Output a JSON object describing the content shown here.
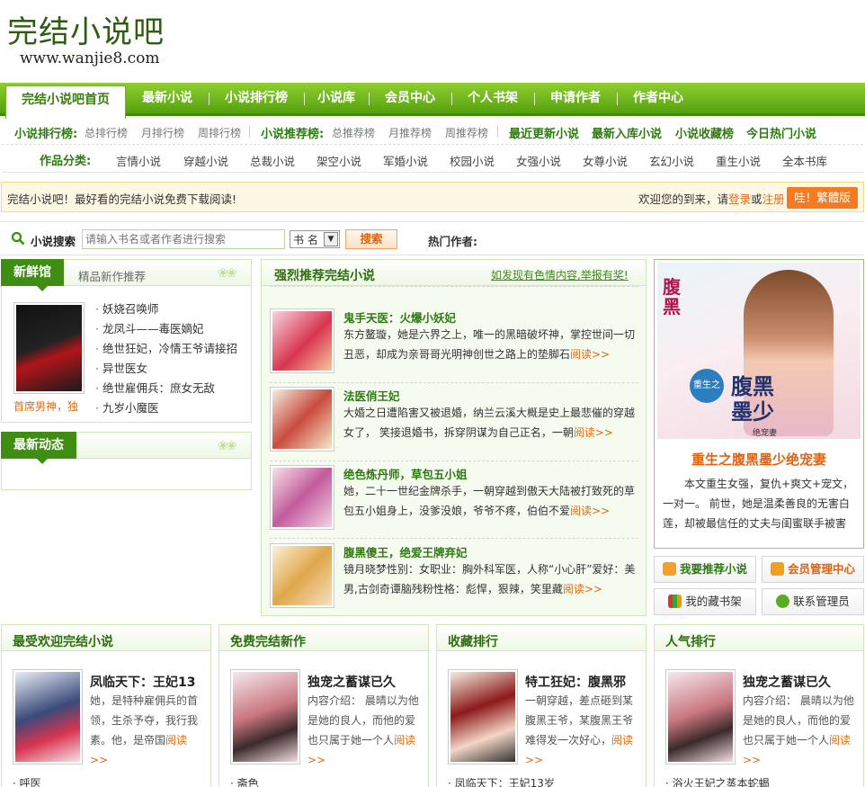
{
  "logo": {
    "cn": "完结小说吧",
    "en": "www.wanjie8.com"
  },
  "nav": [
    "完结小说吧首页",
    "最新小说",
    "小说排行榜",
    "小说库",
    "会员中心",
    "个人书架",
    "申请作者",
    "作者中心"
  ],
  "rank_bar": {
    "rank_title": "小说排行榜:",
    "rank_links": [
      "总排行榜",
      "月排行榜",
      "周排行榜"
    ],
    "rec_title": "小说推荐榜:",
    "rec_links": [
      "总推荐榜",
      "月推荐榜",
      "周推荐榜"
    ],
    "bold_links": [
      "最近更新小说",
      "最新入库小说",
      "小说收藏榜",
      "今日热门小说"
    ]
  },
  "category_bar": {
    "title": "作品分类:",
    "items": [
      "言情小说",
      "穿越小说",
      "总裁小说",
      "架空小说",
      "军婚小说",
      "校园小说",
      "女强小说",
      "女尊小说",
      "玄幻小说",
      "重生小说",
      "全本书库"
    ]
  },
  "notice": {
    "left": "完结小说吧！最好看的完结小说免费下载阅读!",
    "welcome": "欢迎您的到来，请",
    "login": "登录",
    "or": "或",
    "register": "注册",
    "fanti": "哇！繁體版"
  },
  "search": {
    "label": "小说搜索",
    "placeholder": "请输入书名或者作者进行搜索",
    "select": "书 名",
    "button": "搜索",
    "hot_authors": "热门作者:"
  },
  "fresh": {
    "tab": "新鲜馆",
    "subtitle": "精品新作推荐",
    "cover_caption": "首席男神，独",
    "items": [
      "妖娆召唤师",
      "龙凤斗——毒医嫡妃",
      "绝世狂妃，冷情王爷请接招",
      "异世医女",
      "绝世雇佣兵：庶女无敌",
      "九岁小魔医"
    ]
  },
  "dynamic": {
    "tab": "最新动态"
  },
  "recommend": {
    "title": "强烈推荐完结小说",
    "report": "如发现有色情内容,举报有奖!",
    "more": "阅读>>",
    "items": [
      {
        "title": "鬼手天医：火爆小妖妃",
        "desc": "东方鳌璇，她是六界之上，唯一的黑暗破坏神，掌控世间一切丑恶，却成为亲哥哥光明神创世之路上的垫脚石"
      },
      {
        "title": "法医俏王妃",
        "desc": "大婚之日遭陷害又被退婚，纳兰云溪大概是史上最悲催的穿越女了， 笑接退婚书，拆穿阴谋为自己正名，一朝"
      },
      {
        "title": "绝色炼丹师，草包五小姐",
        "desc": "她，二十一世纪金牌杀手，一朝穿越到傲天大陆被打致死的草包五小姐身上，没爹没娘，爷爷不疼，伯伯不爱"
      },
      {
        "title": "腹黑傻王，绝爱王牌弃妃",
        "desc": "镜月晓梦性别：女职业：胸外科军医，人称“小心肝”爱好：美男,古剑奇谭脑残粉性格：彪悍，狠辣，笑里藏"
      }
    ]
  },
  "feature": {
    "title": "重生之腹黑墨少绝宠妻",
    "desc": "本文重生女强，复仇+爽文+宠文，一对一。 前世，她是温柔善良的无害白莲，却被最信任的丈夫与闺蜜联手被害—— “若有来世，无论上天入地，",
    "cover_text_1": "腹黑",
    "cover_text_2": "墨少",
    "cover_text_3": "重生之",
    "cover_text_4": "绝宠妻"
  },
  "actions": [
    "我要推荐小说",
    "会员管理中心",
    "我的藏书架",
    "联系管理员"
  ],
  "bottom": [
    {
      "header": "最受欢迎完结小说",
      "title": "凤临天下：王妃13",
      "desc": "她，是特种雇佣兵的首领，生杀予夺，我行我素。他，是帝国",
      "more": "阅读>>",
      "tail": "· 呼医"
    },
    {
      "header": "免费完结新作",
      "title": "独宠之蓄谋已久",
      "desc": "内容介绍： 晨晴以为他是她的良人，而他的爱也只属于她一个人",
      "more": "阅读>>",
      "tail": "· 斋色"
    },
    {
      "header": "收藏排行",
      "title": "特工狂妃：腹黑邪",
      "desc": "一朝穿越，差点砸到某腹黑王爷，某腹黑王爷难得发一次好心，",
      "more": "阅读>>",
      "tail": "· 凤临天下：王妃13岁"
    },
    {
      "header": "人气排行",
      "title": "独宠之蓄谋已久",
      "desc": "内容介绍： 晨晴以为他是她的良人，而他的爱也只属于她一个人",
      "more": "阅读>>",
      "tail": "· 浴火王妃之蒸本蛇蝎"
    }
  ],
  "colors": {
    "green": "#3f8d12",
    "orange": "#f57b22",
    "nav_green": "#55a00e"
  }
}
